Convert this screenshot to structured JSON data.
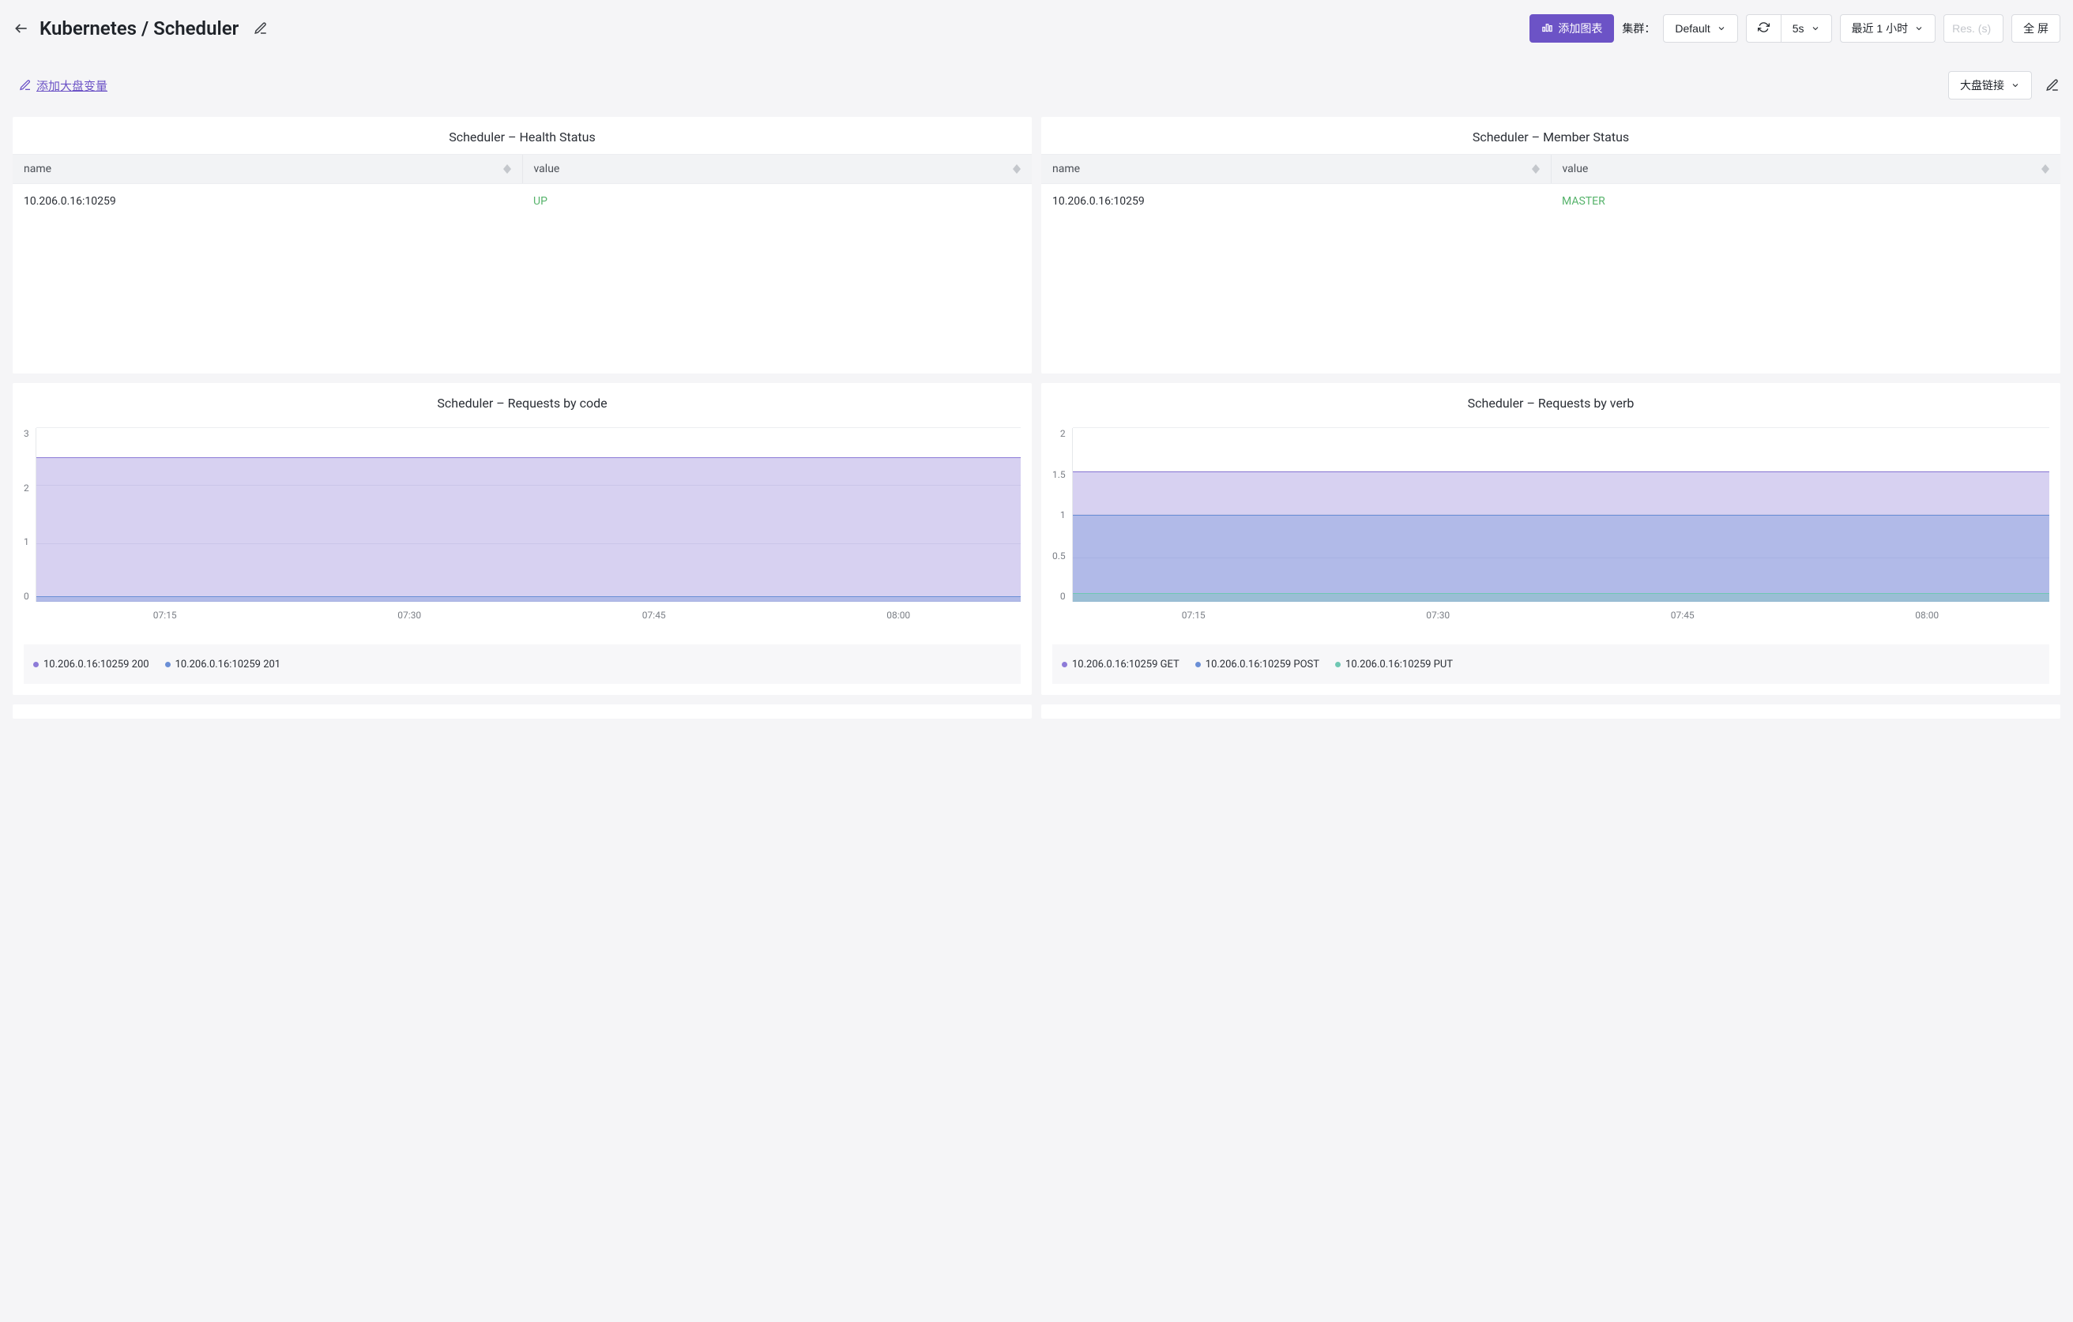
{
  "header": {
    "title": "Kubernetes / Scheduler",
    "add_chart_label": "添加图表",
    "cluster_label": "集群：",
    "cluster_value": "Default",
    "refresh_interval": "5s",
    "time_range": "最近 1 小时",
    "res_placeholder": "Res. (s)",
    "fullscreen_label": "全 屏"
  },
  "second_bar": {
    "add_variable_label": "添加大盘变量",
    "dashboard_link_label": "大盘链接"
  },
  "panels": {
    "health": {
      "title": "Scheduler – Health Status",
      "columns": {
        "name": "name",
        "value": "value"
      },
      "rows": [
        {
          "name": "10.206.0.16:10259",
          "value": "UP"
        }
      ]
    },
    "member": {
      "title": "Scheduler – Member Status",
      "columns": {
        "name": "name",
        "value": "value"
      },
      "rows": [
        {
          "name": "10.206.0.16:10259",
          "value": "MASTER"
        }
      ]
    },
    "req_code": {
      "title": "Scheduler – Requests by code",
      "legend": [
        {
          "label": "10.206.0.16:10259 200",
          "color": "#8d7bd8"
        },
        {
          "label": "10.206.0.16:10259 201",
          "color": "#6b8fd6"
        }
      ]
    },
    "req_verb": {
      "title": "Scheduler – Requests by verb",
      "legend": [
        {
          "label": "10.206.0.16:10259 GET",
          "color": "#8d7bd8"
        },
        {
          "label": "10.206.0.16:10259 POST",
          "color": "#6b8fd6"
        },
        {
          "label": "10.206.0.16:10259 PUT",
          "color": "#6fc7b3"
        }
      ]
    }
  },
  "chart_data": [
    {
      "type": "area",
      "title": "Scheduler – Requests by code",
      "x": [
        "07:15",
        "07:30",
        "07:45",
        "08:00"
      ],
      "ylim": [
        0,
        3
      ],
      "yticks": [
        0,
        1,
        2,
        3
      ],
      "xlabel": "",
      "ylabel": "",
      "series": [
        {
          "name": "10.206.0.16:10259 200",
          "value": 2.5,
          "color": "#8d7bd8"
        },
        {
          "name": "10.206.0.16:10259 201",
          "value": 0.1,
          "color": "#6b8fd6"
        }
      ]
    },
    {
      "type": "area",
      "title": "Scheduler – Requests by verb",
      "x": [
        "07:15",
        "07:30",
        "07:45",
        "08:00"
      ],
      "ylim": [
        0,
        2
      ],
      "yticks": [
        0,
        0.5,
        1,
        1.5,
        2
      ],
      "xlabel": "",
      "ylabel": "",
      "series": [
        {
          "name": "10.206.0.16:10259 GET",
          "value": 1.5,
          "color": "#8d7bd8"
        },
        {
          "name": "10.206.0.16:10259 POST",
          "value": 1.0,
          "color": "#6b8fd6"
        },
        {
          "name": "10.206.0.16:10259 PUT",
          "value": 0.1,
          "color": "#6fc7b3"
        }
      ]
    }
  ]
}
